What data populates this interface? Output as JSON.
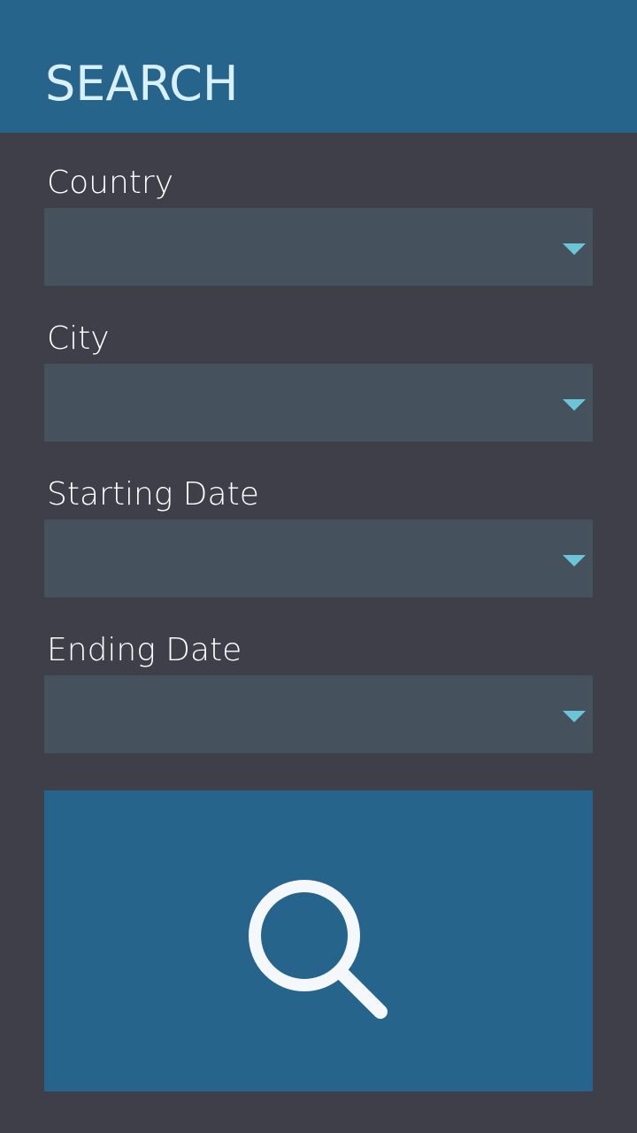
{
  "header": {
    "title": "SEARCH"
  },
  "fields": [
    {
      "label": "Country",
      "value": "",
      "icon": "chevron-down-icon"
    },
    {
      "label": "City",
      "value": "",
      "icon": "chevron-down-icon"
    },
    {
      "label": "Starting Date",
      "value": "",
      "icon": "chevron-down-icon"
    },
    {
      "label": "Ending Date",
      "value": "",
      "icon": "chevron-down-icon"
    }
  ],
  "search_button": {
    "icon": "search-icon"
  },
  "colors": {
    "background": "#3f3f49",
    "header": "#27648b",
    "title_text": "#d7f0fb",
    "select_box": "#45525e",
    "dropdown_arrow": "#6ac6d6",
    "search_button": "#27648b",
    "search_icon": "#f4f8fb"
  }
}
